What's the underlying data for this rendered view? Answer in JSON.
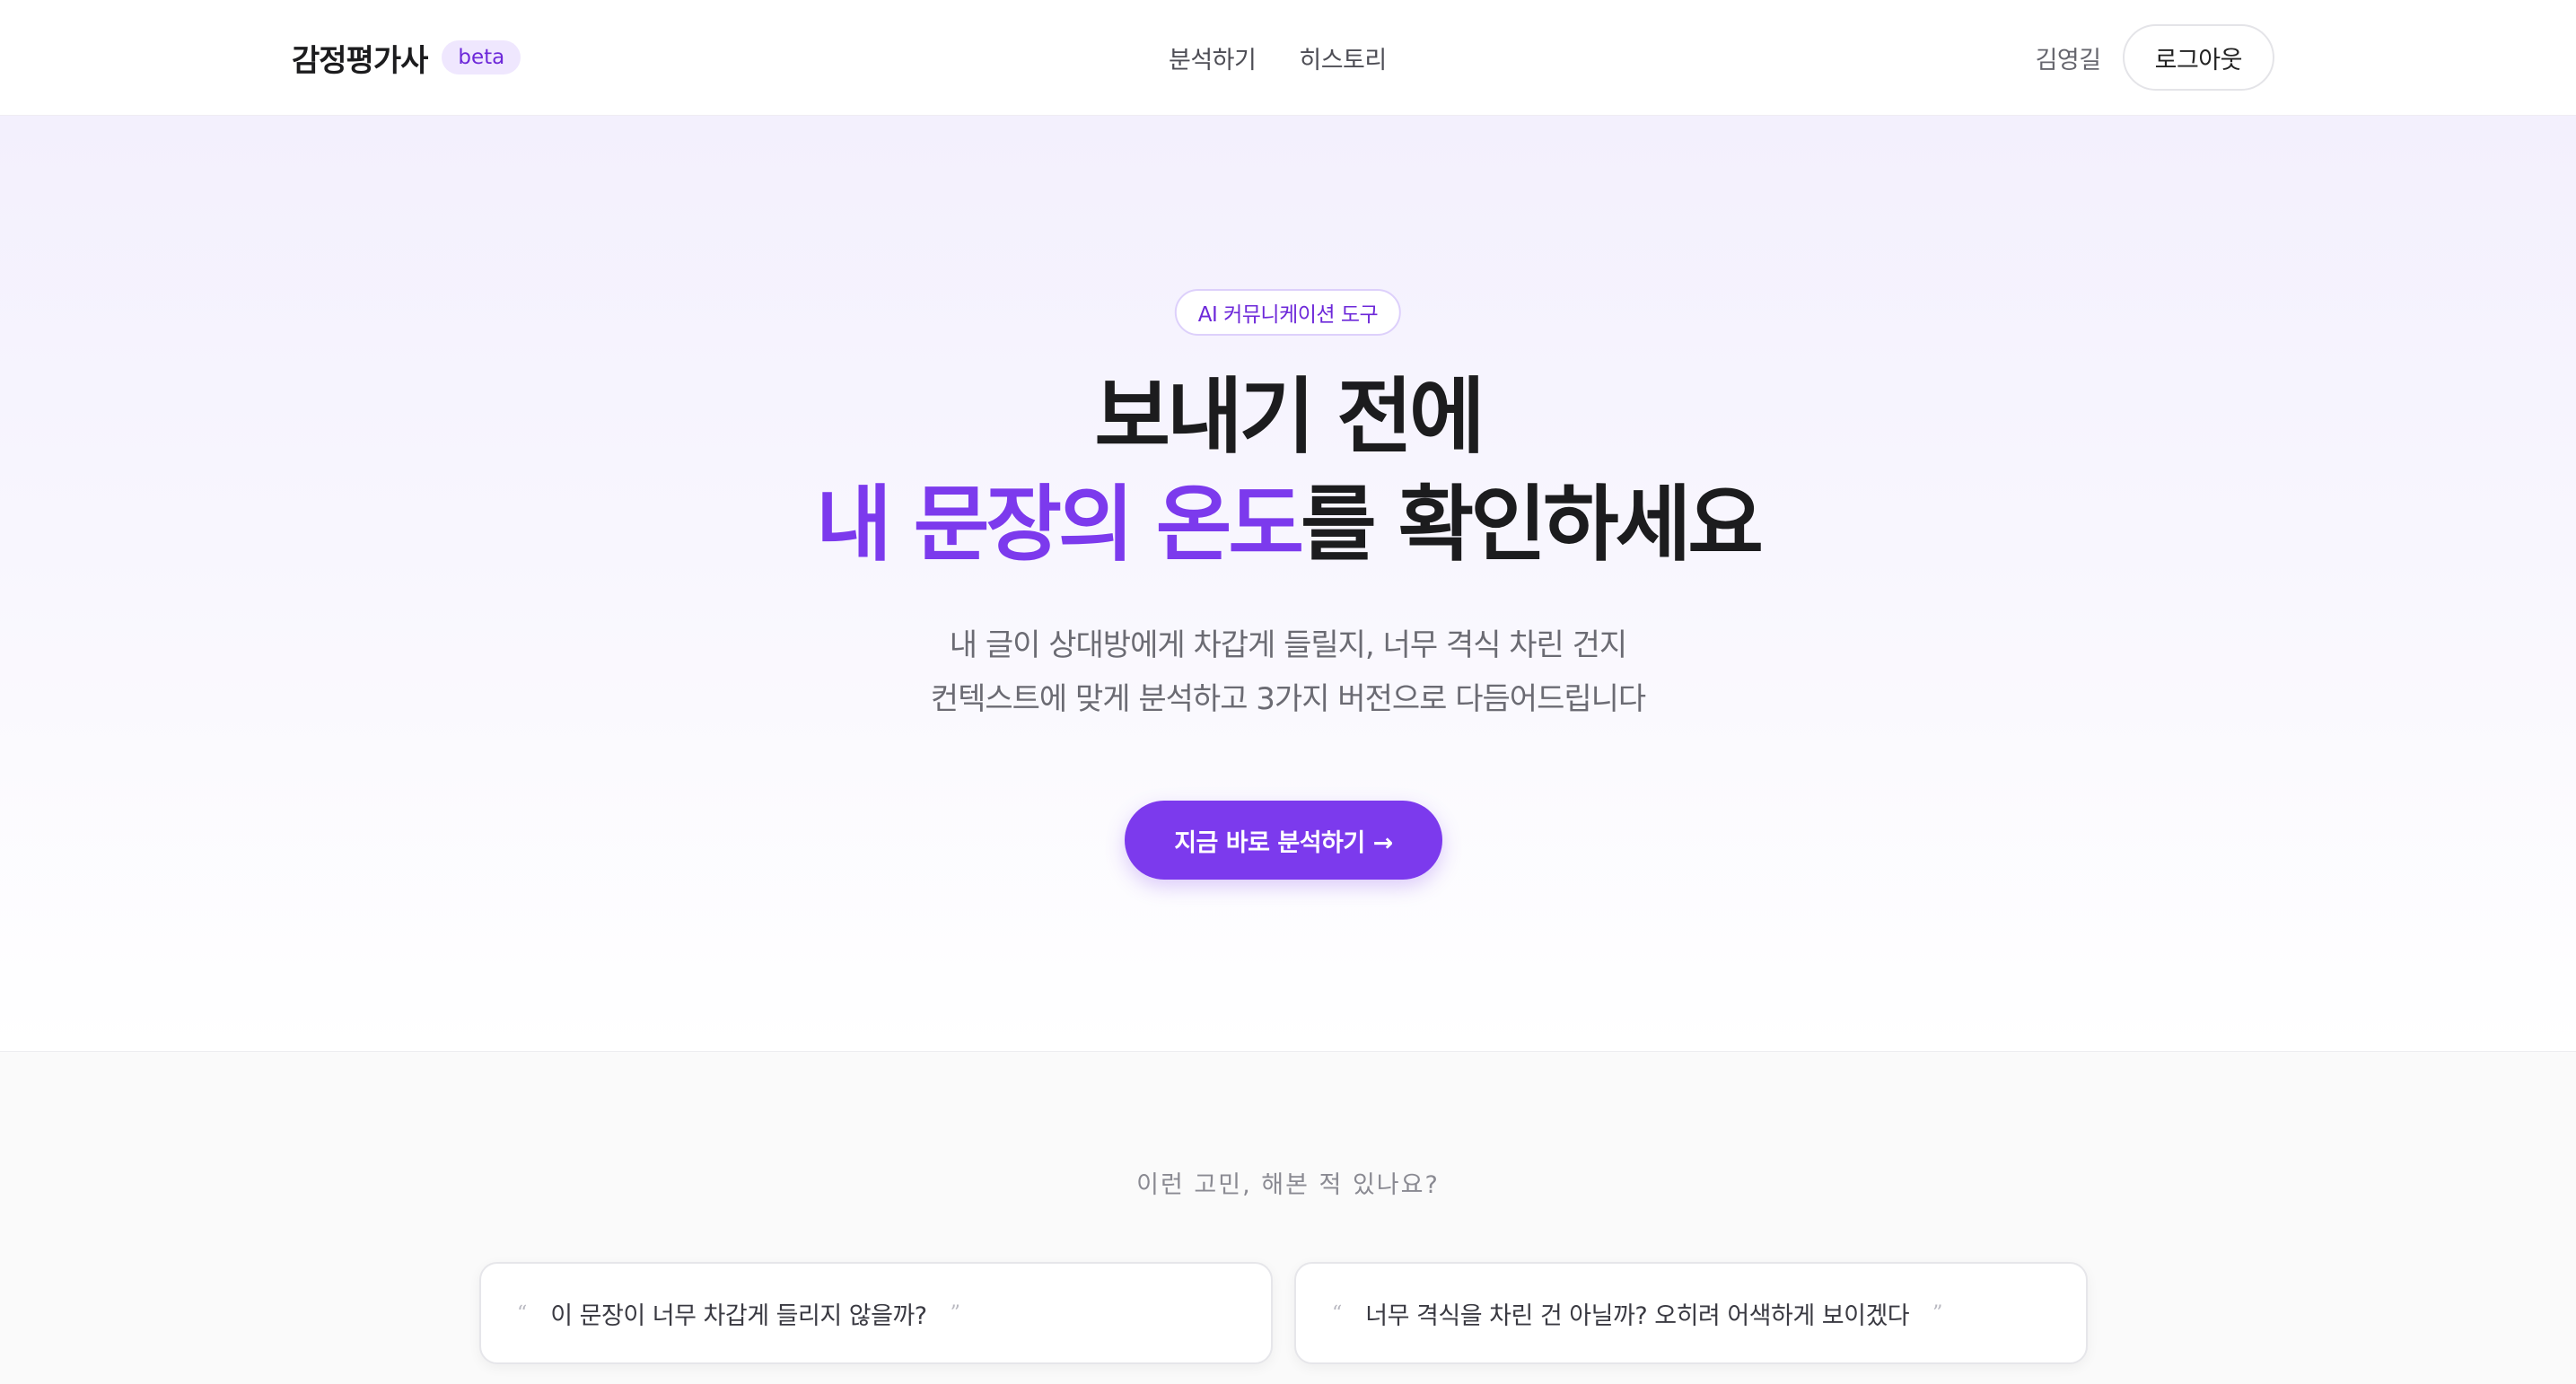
{
  "header": {
    "brand_name": "감정평가사",
    "brand_badge": "beta",
    "nav": [
      {
        "label": "분석하기"
      },
      {
        "label": "히스토리"
      }
    ],
    "user_name": "김영길",
    "logout_label": "로그아웃"
  },
  "hero": {
    "tag": "AI 커뮤니케이션 도구",
    "title_line1": "보내기 전에",
    "title_accent": "내 문장의 온도",
    "title_rest": "를 확인하세요",
    "subtitle_line1": "내 글이 상대방에게 차갑게 들릴지, 너무 격식 차린 건지",
    "subtitle_line2": "컨텍스트에 맞게 분석하고 3가지 버전으로 다듬어드립니다",
    "cta_label": "지금 바로 분석하기 →"
  },
  "concerns": {
    "heading": "이런 고민, 해본 적 있나요?",
    "quote_open": "“",
    "quote_close": "”",
    "items": [
      {
        "text": "이 문장이 너무 차갑게 들리지 않을까?"
      },
      {
        "text": "너무 격식을 차린 건 아닐까? 오히려 어색하게 보이겠다"
      }
    ]
  },
  "colors": {
    "accent": "#7c3aed",
    "badge_bg": "#efe7fe"
  }
}
